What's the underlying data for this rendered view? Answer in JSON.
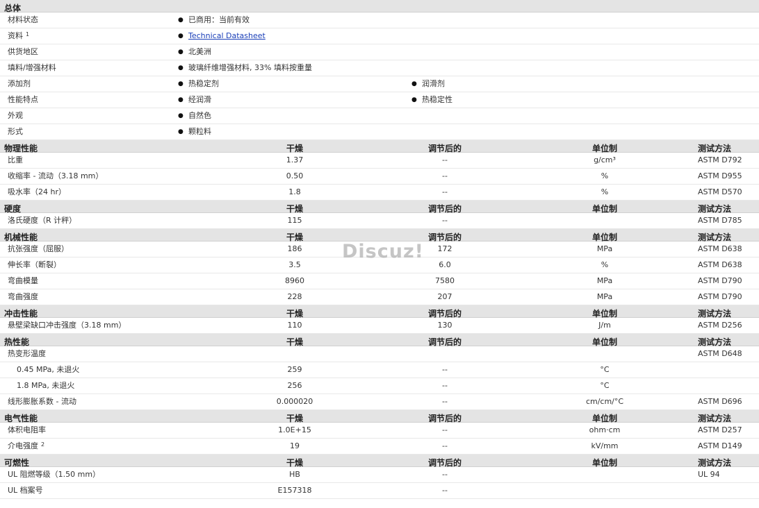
{
  "general": {
    "title": "总体",
    "rows": [
      {
        "label": "材料状态",
        "values": [
          "已商用：当前有效"
        ]
      },
      {
        "label": "资料",
        "sup": "1",
        "values": [
          "Technical Datasheet"
        ],
        "link": true
      },
      {
        "label": "供货地区",
        "values": [
          "北美洲"
        ]
      },
      {
        "label": "填料/增强材料",
        "values": [
          "玻璃纤维增强材料, 33% 填料按重量"
        ]
      },
      {
        "label": "添加剂",
        "values": [
          "热稳定剂",
          "润滑剂"
        ]
      },
      {
        "label": "性能特点",
        "values": [
          "经润滑",
          "热稳定性"
        ]
      },
      {
        "label": "外观",
        "values": [
          "自然色"
        ]
      },
      {
        "label": "形式",
        "values": [
          "颗粒料"
        ]
      }
    ]
  },
  "columns": {
    "dry": "干燥",
    "conditioned": "调节后的",
    "unit": "单位制",
    "method": "测试方法"
  },
  "sections": [
    {
      "title": "物理性能",
      "rows": [
        {
          "label": "比重",
          "dry": "1.37",
          "cond": "--",
          "unit": "g/cm³",
          "method": "ASTM D792"
        },
        {
          "label": "收缩率 - 流动（3.18 mm）",
          "dry": "0.50",
          "cond": "--",
          "unit": "%",
          "method": "ASTM D955"
        },
        {
          "label": "吸水率（24 hr）",
          "dry": "1.8",
          "cond": "--",
          "unit": "%",
          "method": "ASTM D570"
        }
      ]
    },
    {
      "title": "硬度",
      "rows": [
        {
          "label": "洛氏硬度（R 计秤）",
          "dry": "115",
          "cond": "--",
          "unit": "",
          "method": "ASTM D785"
        }
      ]
    },
    {
      "title": "机械性能",
      "rows": [
        {
          "label": "抗张强度（屈服）",
          "dry": "186",
          "cond": "172",
          "unit": "MPa",
          "method": "ASTM D638"
        },
        {
          "label": "伸长率（断裂）",
          "dry": "3.5",
          "cond": "6.0",
          "unit": "%",
          "method": "ASTM D638"
        },
        {
          "label": "弯曲模量",
          "dry": "8960",
          "cond": "7580",
          "unit": "MPa",
          "method": "ASTM D790"
        },
        {
          "label": "弯曲强度",
          "dry": "228",
          "cond": "207",
          "unit": "MPa",
          "method": "ASTM D790"
        }
      ]
    },
    {
      "title": "冲击性能",
      "rows": [
        {
          "label": "悬壁梁缺口冲击强度（3.18 mm）",
          "dry": "110",
          "cond": "130",
          "unit": "J/m",
          "method": "ASTM D256"
        }
      ]
    },
    {
      "title": "热性能",
      "rows": [
        {
          "label": "热变形温度",
          "dry": "",
          "cond": "",
          "unit": "",
          "method": "ASTM D648"
        },
        {
          "label": "0.45 MPa, 未退火",
          "dry": "259",
          "cond": "--",
          "unit": "°C",
          "method": "",
          "indent": true
        },
        {
          "label": "1.8 MPa, 未退火",
          "dry": "256",
          "cond": "--",
          "unit": "°C",
          "method": "",
          "indent": true
        },
        {
          "label": "线形膨胀系数 - 流动",
          "dry": "0.000020",
          "cond": "--",
          "unit": "cm/cm/°C",
          "method": "ASTM D696"
        }
      ]
    },
    {
      "title": "电气性能",
      "rows": [
        {
          "label": "体积电阻率",
          "dry": "1.0E+15",
          "cond": "--",
          "unit": "ohm·cm",
          "method": "ASTM D257"
        },
        {
          "label": "介电强度",
          "sup": "2",
          "dry": "19",
          "cond": "--",
          "unit": "kV/mm",
          "method": "ASTM D149"
        }
      ]
    },
    {
      "title": "可燃性",
      "rows": [
        {
          "label": "UL 阻燃等级（1.50 mm）",
          "dry": "HB",
          "cond": "--",
          "unit": "",
          "method": "UL 94"
        },
        {
          "label": "UL 档案号",
          "dry": "E157318",
          "cond": "--",
          "unit": "",
          "method": ""
        }
      ]
    }
  ],
  "watermark": "Discuz!"
}
